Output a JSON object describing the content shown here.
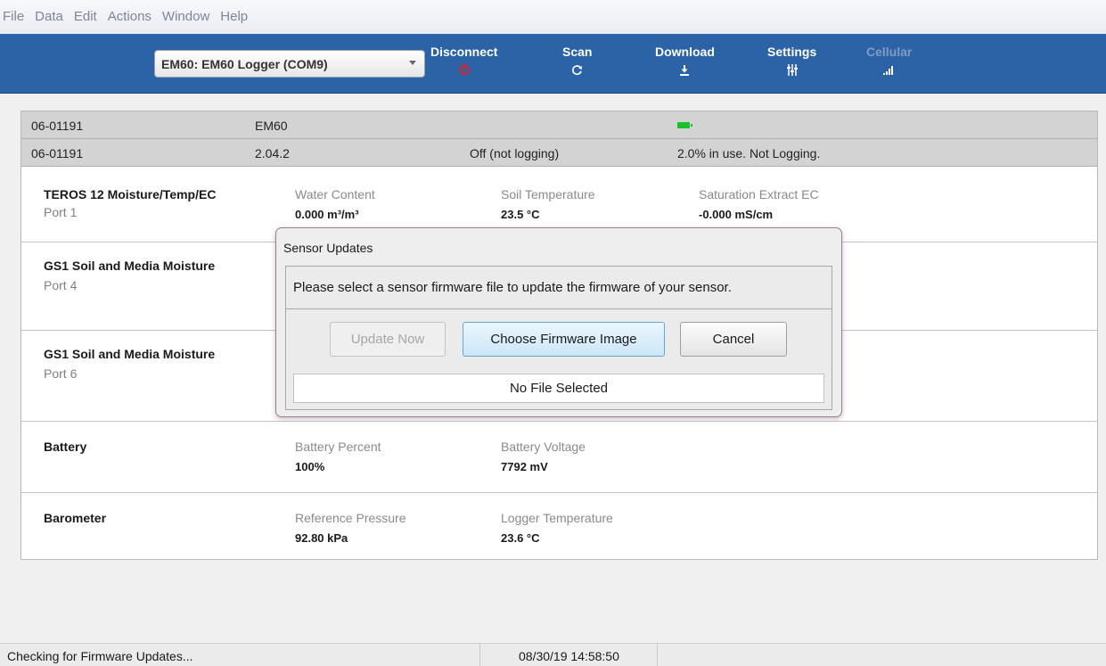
{
  "menu": [
    "File",
    "Data",
    "Edit",
    "Actions",
    "Window",
    "Help"
  ],
  "toolbar": {
    "logger_select": "EM60: EM60 Logger (COM9)",
    "buttons": [
      {
        "label": "Disconnect",
        "icon": "power-icon",
        "enabled": true
      },
      {
        "label": "Scan",
        "icon": "refresh-icon",
        "enabled": true
      },
      {
        "label": "Download",
        "icon": "download-icon",
        "enabled": true
      },
      {
        "label": "Settings",
        "icon": "sliders-icon",
        "enabled": true
      },
      {
        "label": "Cellular",
        "icon": "signal-icon",
        "enabled": false
      }
    ],
    "colors": {
      "background": "#2b63a6",
      "disconnect_icon": "#e0202a"
    }
  },
  "device": {
    "row1": {
      "serial": "06-01191",
      "model": "EM60",
      "battery_icon": "battery-full-icon"
    },
    "row2": {
      "serial": "06-01191",
      "firmware": "2.04.2",
      "logging": "Off (not logging)",
      "memory": "2.0% in use.  Not Logging."
    }
  },
  "sensors": [
    {
      "name": "TEROS 12 Moisture/Temp/EC",
      "port": "Port 1",
      "measurements": [
        {
          "label": "Water Content",
          "value": "0.000 m³/m³"
        },
        {
          "label": "Soil Temperature",
          "value": "23.5 °C"
        },
        {
          "label": "Saturation Extract EC",
          "value": "-0.000 mS/cm"
        }
      ]
    },
    {
      "name": "GS1 Soil and Media Moisture",
      "port": "Port 4"
    },
    {
      "name": "GS1 Soil and Media Moisture",
      "port": "Port 6"
    },
    {
      "name": "Battery",
      "measurements": [
        {
          "label": "Battery Percent",
          "value": "100%"
        },
        {
          "label": "Battery Voltage",
          "value": "7792 mV"
        }
      ]
    },
    {
      "name": "Barometer",
      "measurements": [
        {
          "label": "Reference Pressure",
          "value": "92.80 kPa"
        },
        {
          "label": "Logger Temperature",
          "value": "23.6 °C"
        }
      ]
    }
  ],
  "dialog": {
    "title": "Sensor Updates",
    "message": "Please select a sensor firmware file to update the firmware of your sensor.",
    "buttons": {
      "update_now": "Update Now",
      "choose_image": "Choose Firmware Image",
      "cancel": "Cancel"
    },
    "file_status": "No File Selected"
  },
  "statusbar": {
    "message": "Checking for Firmware Updates...",
    "timestamp": "08/30/19 14:58:50"
  }
}
